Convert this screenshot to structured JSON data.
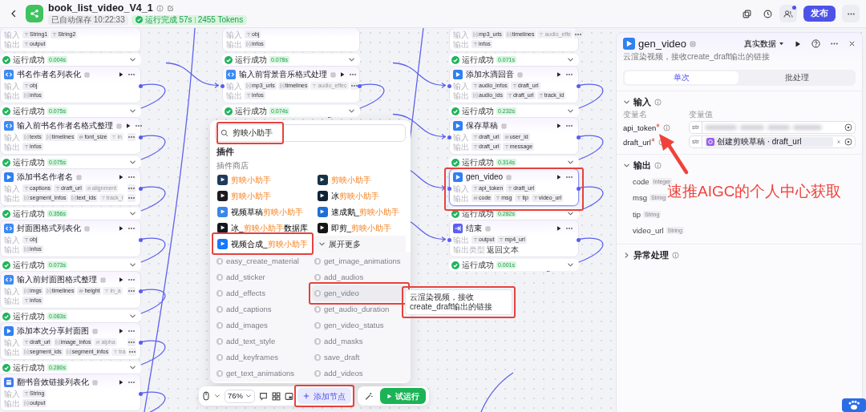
{
  "header": {
    "title": "book_list_video_V4_1",
    "autosave": "已自动保存 10:22:33",
    "run_result": "运行完成 57s",
    "tokens": "2455 Tokens",
    "notification": true,
    "publish": "发布"
  },
  "canvas": {
    "columns": [
      {
        "nodes": [
          {
            "rows": [
              {
                "label": "输入",
                "more": false,
                "params": [
                  {
                    "kind": "str",
                    "name": "String1"
                  },
                  {
                    "kind": "str",
                    "name": "String2"
                  }
                ]
              },
              {
                "label": "输出",
                "more": false,
                "params": [
                  {
                    "kind": "str",
                    "name": "output"
                  }
                ]
              }
            ]
          },
          {
            "status": "运行成功",
            "time": "0.004s",
            "title": "书名作者名列表化",
            "kind": "code",
            "selected": false,
            "highlighted": false,
            "rows": [
              {
                "label": "输入",
                "more": false,
                "params": [
                  {
                    "kind": "str",
                    "name": "obj"
                  }
                ]
              },
              {
                "label": "输出",
                "more": false,
                "params": [
                  {
                    "kind": "list",
                    "name": "infos"
                  }
                ]
              }
            ]
          },
          {
            "status": "运行成功",
            "time": "0.075s",
            "title": "输入前书名作者名格式整理",
            "kind": "code",
            "selected": false,
            "highlighted": false,
            "rows": [
              {
                "label": "输入",
                "more": true,
                "params": [
                  {
                    "kind": "list",
                    "name": "texts"
                  },
                  {
                    "kind": "list",
                    "name": "timelines"
                  },
                  {
                    "kind": "int",
                    "name": "font_size"
                  }
                ],
                "overflow": [
                  {
                    "kind": "str",
                    "name": "in"
                  }
                ]
              },
              {
                "label": "输出",
                "more": false,
                "params": [
                  {
                    "kind": "str",
                    "name": "infos"
                  }
                ]
              }
            ]
          },
          {
            "status": "运行成功",
            "time": "0.075s",
            "title": "添加书名作者名",
            "kind": "plugin",
            "selected": false,
            "highlighted": false,
            "rows": [
              {
                "label": "输入",
                "more": true,
                "params": [
                  {
                    "kind": "str",
                    "name": "captions"
                  },
                  {
                    "kind": "str",
                    "name": "draft_url"
                  }
                ],
                "overflow": [
                  {
                    "kind": "int",
                    "name": "alignment"
                  }
                ]
              },
              {
                "label": "输出",
                "more": true,
                "params": [
                  {
                    "kind": "list",
                    "name": "segment_infos"
                  },
                  {
                    "kind": "list",
                    "name": "text_ids"
                  }
                ],
                "overflow": [
                  {
                    "kind": "str",
                    "name": "track_i"
                  }
                ]
              }
            ]
          },
          {
            "status": "运行成功",
            "time": "0.356s",
            "title": "封面图格式列表化",
            "kind": "code",
            "selected": false,
            "highlighted": false,
            "rows": [
              {
                "label": "输入",
                "more": false,
                "params": [
                  {
                    "kind": "str",
                    "name": "obj"
                  }
                ]
              },
              {
                "label": "输出",
                "more": false,
                "params": [
                  {
                    "kind": "list",
                    "name": "infos"
                  }
                ]
              }
            ]
          },
          {
            "status": "运行成功",
            "time": "0.073s",
            "title": "输入前封面图格式整理",
            "kind": "code",
            "selected": false,
            "highlighted": false,
            "rows": [
              {
                "label": "输入",
                "more": true,
                "params": [
                  {
                    "kind": "list",
                    "name": "imgs"
                  },
                  {
                    "kind": "list",
                    "name": "timelines"
                  },
                  {
                    "kind": "int",
                    "name": "height"
                  }
                ],
                "overflow": [
                  {
                    "kind": "str",
                    "name": "in_a"
                  }
                ]
              },
              {
                "label": "输出",
                "more": false,
                "params": [
                  {
                    "kind": "str",
                    "name": "infos"
                  }
                ]
              }
            ]
          },
          {
            "status": "运行成功",
            "time": "0.083s",
            "title": "添加本次分享封面图",
            "kind": "plugin",
            "selected": false,
            "highlighted": false,
            "rows": [
              {
                "label": "输入",
                "more": true,
                "params": [
                  {
                    "kind": "str",
                    "name": "draft_url"
                  },
                  {
                    "kind": "list",
                    "name": "image_infos"
                  }
                ],
                "overflow": [
                  {
                    "kind": "int",
                    "name": "alpha"
                  }
                ]
              },
              {
                "label": "输出",
                "more": true,
                "params": [
                  {
                    "kind": "list",
                    "name": "segment_ids"
                  },
                  {
                    "kind": "list",
                    "name": "segment_infos"
                  }
                ],
                "overflow": [
                  {
                    "kind": "str",
                    "name": "tra"
                  }
                ]
              }
            ]
          },
          {
            "status": "运行成功",
            "time": "0.280s",
            "title": "翻书音效链接列表化",
            "kind": "box",
            "selected": false,
            "highlighted": false,
            "rows": [
              {
                "label": "输入",
                "more": false,
                "params": [
                  {
                    "kind": "str",
                    "name": "String"
                  }
                ]
              },
              {
                "label": "输出",
                "more": false,
                "params": [
                  {
                    "kind": "list",
                    "name": "output"
                  }
                ]
              }
            ]
          }
        ]
      },
      {
        "nodes": [
          {
            "rows": [
              {
                "label": "输入",
                "more": false,
                "params": [
                  {
                    "kind": "str",
                    "name": "obj"
                  }
                ]
              },
              {
                "label": "输出",
                "more": false,
                "params": [
                  {
                    "kind": "list",
                    "name": "infos"
                  }
                ]
              }
            ]
          },
          {
            "status": "运行成功",
            "time": "0.078s",
            "title": "输入前背景音乐格式处理",
            "kind": "code",
            "selected": false,
            "highlighted": false,
            "rows": [
              {
                "label": "输入",
                "more": true,
                "params": [
                  {
                    "kind": "list",
                    "name": "mp3_urls"
                  },
                  {
                    "kind": "list",
                    "name": "timelines"
                  }
                ],
                "overflow": [
                  {
                    "kind": "str",
                    "name": "audio_effec"
                  }
                ]
              },
              {
                "label": "输出",
                "more": false,
                "params": [
                  {
                    "kind": "str",
                    "name": "infos"
                  }
                ]
              }
            ]
          },
          {
            "status": "运行成功",
            "time": "0.074s"
          }
        ]
      },
      {
        "nodes": [
          {
            "rows": [
              {
                "label": "输入",
                "more": true,
                "params": [
                  {
                    "kind": "list",
                    "name": "mp3_urls"
                  },
                  {
                    "kind": "list",
                    "name": "timelines"
                  }
                ],
                "overflow": [
                  {
                    "kind": "str",
                    "name": "audio_effe"
                  }
                ]
              },
              {
                "label": "输出",
                "more": false,
                "params": [
                  {
                    "kind": "str",
                    "name": "infos"
                  }
                ]
              }
            ]
          },
          {
            "status": "运行成功",
            "time": "0.071s",
            "title": "添加水滴回音",
            "kind": "plugin",
            "selected": false,
            "highlighted": false,
            "rows": [
              {
                "label": "输入",
                "more": false,
                "params": [
                  {
                    "kind": "str",
                    "name": "audio_infos"
                  },
                  {
                    "kind": "str",
                    "name": "draft_url"
                  }
                ]
              },
              {
                "label": "输出",
                "more": false,
                "params": [
                  {
                    "kind": "list",
                    "name": "audio_ids"
                  },
                  {
                    "kind": "str",
                    "name": "draft_url"
                  },
                  {
                    "kind": "str",
                    "name": "track_id"
                  }
                ]
              }
            ]
          },
          {
            "status": "运行成功",
            "time": "0.232s",
            "title": "保存草稿",
            "kind": "plugin",
            "selected": false,
            "highlighted": false,
            "rows": [
              {
                "label": "输入",
                "more": false,
                "params": [
                  {
                    "kind": "str",
                    "name": "draft_url"
                  },
                  {
                    "kind": "int",
                    "name": "user_id"
                  }
                ]
              },
              {
                "label": "输出",
                "more": false,
                "params": [
                  {
                    "kind": "str",
                    "name": "draft_url"
                  },
                  {
                    "kind": "str",
                    "name": "message"
                  }
                ]
              }
            ]
          },
          {
            "status": "运行成功",
            "time": "0.314s",
            "title": "gen_video",
            "kind": "plugin",
            "selected": true,
            "highlighted": true,
            "rows": [
              {
                "label": "输入",
                "more": false,
                "params": [
                  {
                    "kind": "str",
                    "name": "api_token"
                  },
                  {
                    "kind": "str",
                    "name": "draft_url"
                  }
                ]
              },
              {
                "label": "输出",
                "more": false,
                "params": [
                  {
                    "kind": "int",
                    "name": "code"
                  },
                  {
                    "kind": "str",
                    "name": "msg"
                  },
                  {
                    "kind": "str",
                    "name": "tip"
                  },
                  {
                    "kind": "str",
                    "name": "video_url"
                  }
                ]
              }
            ]
          },
          {
            "status": "运行成功",
            "time": "0.282s",
            "title": "结束",
            "kind": "end",
            "selected": false,
            "highlighted": false,
            "rows": [
              {
                "label": "输出",
                "more": false,
                "params": [
                  {
                    "kind": "str",
                    "name": "output"
                  },
                  {
                    "kind": "str",
                    "name": "mp4_url"
                  }
                ]
              },
              {
                "label": "输出类型",
                "value": "返回文本"
              }
            ]
          },
          {
            "status": "运行成功",
            "time": "0.001s"
          }
        ]
      }
    ]
  },
  "add_node_panel": {
    "search": {
      "value": "剪映小助手",
      "highlighted": true
    },
    "section": "插件",
    "store": "插件商店",
    "plugins": [
      {
        "color": "#1e3a5c",
        "highlighted": false,
        "parts": [
          {
            "text": "剪映小助手",
            "match": true
          }
        ]
      },
      {
        "color": "#173247",
        "highlighted": false,
        "parts": [
          {
            "text": "剪映小助手",
            "match": true
          }
        ]
      },
      {
        "color": "#1b1b1f",
        "highlighted": false,
        "parts": [
          {
            "text": "剪映小助手",
            "match": true
          }
        ]
      },
      {
        "color": "#0f2233",
        "highlighted": false,
        "parts": [
          {
            "text": "冰",
            "match": false
          },
          {
            "text": "剪映小助手",
            "match": true
          }
        ]
      },
      {
        "color": "#3b87e8",
        "highlighted": false,
        "parts": [
          {
            "text": "视频草稿",
            "match": false
          },
          {
            "text": "剪映小助手",
            "match": true
          }
        ]
      },
      {
        "color": "#1f6fd6",
        "highlighted": false,
        "parts": [
          {
            "text": "速成鹅_",
            "match": false
          },
          {
            "text": "剪映小助手",
            "match": true
          }
        ]
      },
      {
        "color": "#11181f",
        "highlighted": false,
        "parts": [
          {
            "text": "冰_",
            "match": false
          },
          {
            "text": "剪映小助手",
            "match": true
          },
          {
            "text": "数据库",
            "match": false
          }
        ]
      },
      {
        "color": "#161616",
        "highlighted": false,
        "parts": [
          {
            "text": "即剪_",
            "match": false
          },
          {
            "text": "剪映小助手",
            "match": true
          }
        ]
      },
      {
        "color": "#1677ff",
        "highlighted": true,
        "parts": [
          {
            "text": "视频合成_",
            "match": false
          },
          {
            "text": "剪映小助手",
            "match": true
          }
        ]
      }
    ],
    "expand_more": "展开更多",
    "tools": [
      {
        "name": "easy_create_material",
        "hovered": false,
        "highlighted": false
      },
      {
        "name": "get_image_animations",
        "hovered": false,
        "highlighted": false
      },
      {
        "name": "add_sticker",
        "hovered": false,
        "highlighted": false
      },
      {
        "name": "add_audios",
        "hovered": false,
        "highlighted": false
      },
      {
        "name": "add_effects",
        "hovered": false,
        "highlighted": false
      },
      {
        "name": "gen_video",
        "hovered": true,
        "highlighted": true
      },
      {
        "name": "add_captions",
        "hovered": false,
        "highlighted": false
      },
      {
        "name": "get_audio_duration",
        "hovered": false,
        "highlighted": false
      },
      {
        "name": "add_images",
        "hovered": false,
        "highlighted": false
      },
      {
        "name": "gen_video_status",
        "hovered": false,
        "highlighted": false
      },
      {
        "name": "add_text_style",
        "hovered": false,
        "highlighted": false
      },
      {
        "name": "add_masks",
        "hovered": false,
        "highlighted": false
      },
      {
        "name": "add_keyframes",
        "hovered": false,
        "highlighted": false
      },
      {
        "name": "save_draft",
        "hovered": false,
        "highlighted": false
      },
      {
        "name": "get_text_animations",
        "hovered": false,
        "highlighted": false
      },
      {
        "name": "add_videos",
        "hovered": false,
        "highlighted": false
      }
    ],
    "tooltip": {
      "text": "云渲染视频，接收create_draft输出的链接",
      "highlighted": true
    }
  },
  "toolbar": {
    "zoom": "76%",
    "add_node": "添加节点",
    "add_node_highlighted": true,
    "test_run": "试运行"
  },
  "inspector": {
    "title": "gen_video",
    "data_source": "真实数据",
    "description": "云渲染视频，接收create_draft输出的链接",
    "tabs": [
      {
        "label": "单次",
        "selected": true
      },
      {
        "label": "批处理",
        "selected": false
      }
    ],
    "sections": [
      {
        "kind": "inputs",
        "title": "输入",
        "expanded": true,
        "name_header": "变量名",
        "value_header": "变量值",
        "params": [
          {
            "name": "api_token",
            "required": true,
            "type": "str",
            "kind": "redacted"
          },
          {
            "name": "draft_url",
            "required": true,
            "type": "str",
            "kind": "reference",
            "reference": "创建剪映草稿 · draft_url"
          }
        ]
      },
      {
        "kind": "outputs",
        "title": "输出",
        "expanded": true,
        "params": [
          {
            "name": "code",
            "type": "Integer"
          },
          {
            "name": "msg",
            "type": "String"
          },
          {
            "name": "tip",
            "type": "String"
          },
          {
            "name": "video_url",
            "type": "String"
          }
        ]
      },
      {
        "title": "异常处理",
        "expanded": false
      }
    ]
  },
  "annotation": {
    "text": "速推AIGC的个人中心获取"
  }
}
